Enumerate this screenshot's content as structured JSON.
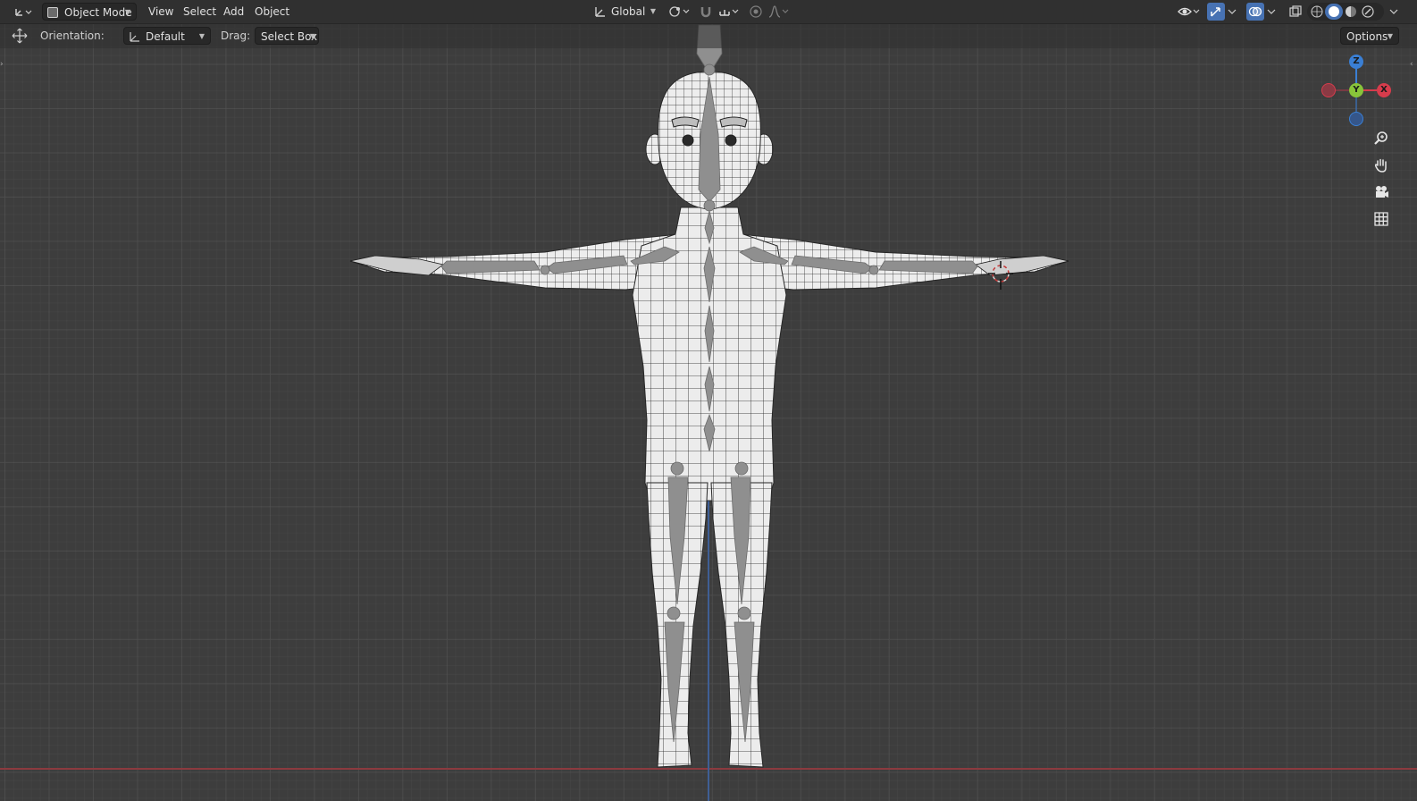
{
  "header": {
    "editor_type_icon": "axes-icon",
    "mode": "Object Mode",
    "menus": [
      "View",
      "Select",
      "Add",
      "Object"
    ],
    "transform_orientation": "Global",
    "icons": {
      "pivot": "pivot-icon",
      "snap": "magnet-icon",
      "snap_target": "snap-increment-icon",
      "proportional": "proportional-edit-icon",
      "falloff": "falloff-curve-icon",
      "visibility": "eye-icon",
      "gizmos": "gizmo-icon",
      "overlays": "overlays-icon",
      "xray": "xray-icon",
      "shading_wire": "wireframe-shading-icon",
      "shading_solid": "solid-shading-icon",
      "shading_material": "material-shading-icon",
      "shading_render": "rendered-shading-icon"
    },
    "accent_color": "#4772b3"
  },
  "tool_settings": {
    "tool_icon": "transform-tool-icon",
    "orientation_label": "Orientation:",
    "orientation_value": "Default",
    "drag_label": "Drag:",
    "drag_value": "Select Box",
    "options_label": "Options"
  },
  "gizmo": {
    "z": "Z",
    "y": "Y",
    "x": "X",
    "colors": {
      "x": "#d63c4c",
      "y": "#88c43a",
      "z": "#3a7fd4"
    }
  },
  "navigation": {
    "zoom": "zoom-icon",
    "pan": "hand-icon",
    "camera": "camera-icon",
    "ortho": "grid-icon"
  },
  "scene": {
    "object": "character-mesh",
    "armature_color": "#8f8f8f",
    "mesh_color": "#ececec",
    "x_axis_color": "#a83a3f",
    "y_axis_color": "#3a65a8"
  }
}
